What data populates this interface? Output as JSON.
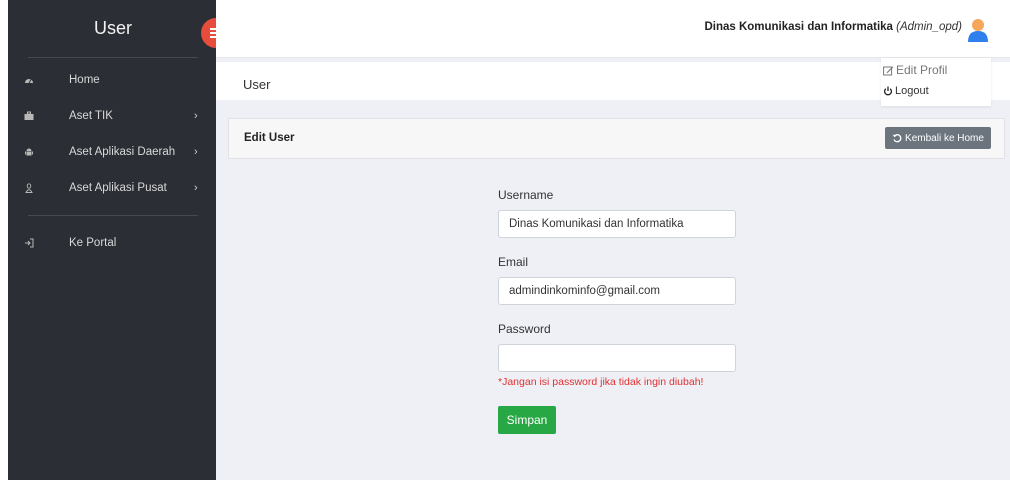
{
  "sidebar": {
    "brand": "User",
    "items": [
      {
        "label": "Home",
        "icon": "dashboard-icon",
        "has_chevron": false
      },
      {
        "label": "Aset TIK",
        "icon": "briefcase-icon",
        "has_chevron": true
      },
      {
        "label": "Aset Aplikasi Daerah",
        "icon": "android-icon",
        "has_chevron": true
      },
      {
        "label": "Aset Aplikasi Pusat",
        "icon": "linux-icon",
        "has_chevron": true
      }
    ],
    "portal_label": "Ke Portal",
    "chevron": "›"
  },
  "topbar": {
    "org_name": "Dinas Komunikasi dan Informatika",
    "role": "(Admin_opd)"
  },
  "user_menu": {
    "edit_profile": "Edit Profil",
    "logout": "Logout"
  },
  "page": {
    "title": "User"
  },
  "card": {
    "title": "Edit User",
    "back_button": "Kembali ke Home"
  },
  "form": {
    "username_label": "Username",
    "username_value": "Dinas Komunikasi dan Informatika",
    "email_label": "Email",
    "email_value": "admindinkominfo@gmail.com",
    "password_label": "Password",
    "password_value": "",
    "password_hint": "*Jangan isi password jika tidak ingin diubah!",
    "submit_label": "Simpan"
  },
  "colors": {
    "sidebar_bg": "#2b2f35",
    "toggle_red": "#e74c3c",
    "content_bg": "#eef0f6",
    "back_button_gray": "#6c757d",
    "save_green": "#28a745",
    "hint_red": "#e03131",
    "avatar_orange": "#f5a65b",
    "avatar_blue": "#2f80ed"
  }
}
